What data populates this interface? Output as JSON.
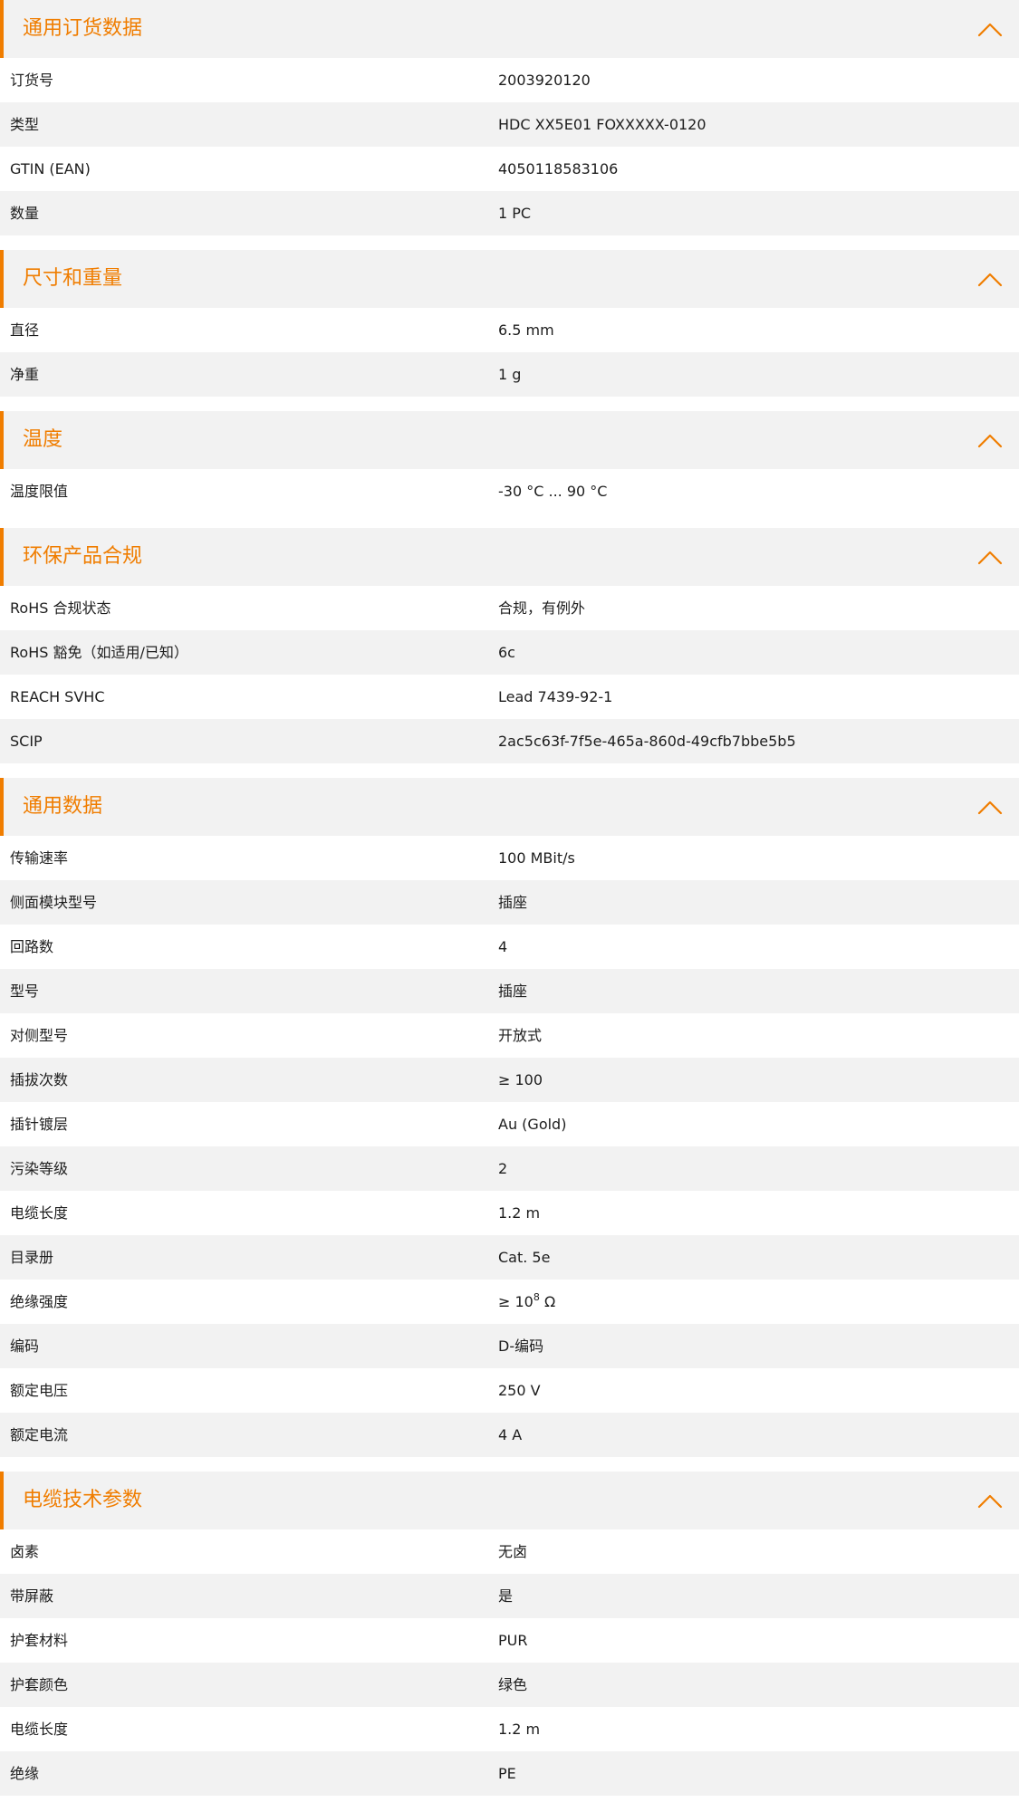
{
  "accent_color": "#f07d00",
  "icons": {
    "collapse": "chevron-up-icon"
  },
  "sections": [
    {
      "id": "ordering",
      "title": "通用订货数据",
      "rows": [
        {
          "label": "订货号",
          "value": "2003920120"
        },
        {
          "label": "类型",
          "value": "HDC XX5E01 FOXXXXX-0120"
        },
        {
          "label": "GTIN (EAN)",
          "value": "4050118583106"
        },
        {
          "label": "数量",
          "value": "1  PC"
        }
      ]
    },
    {
      "id": "dimensions",
      "title": "尺寸和重量",
      "rows": [
        {
          "label": "直径",
          "value": "6.5  mm"
        },
        {
          "label": "净重",
          "value": "1  g"
        }
      ]
    },
    {
      "id": "temperature",
      "title": "温度",
      "rows": [
        {
          "label": "温度限值",
          "value": "-30 °C ... 90 °C"
        }
      ]
    },
    {
      "id": "compliance",
      "title": "环保产品合规",
      "rows": [
        {
          "label": "RoHS 合规状态",
          "value": "合规，有例外"
        },
        {
          "label": "RoHS 豁免（如适用/已知）",
          "value": "6c"
        },
        {
          "label": "REACH SVHC",
          "value": "Lead 7439-92-1"
        },
        {
          "label": "SCIP",
          "value": "2ac5c63f-7f5e-465a-860d-49cfb7bbe5b5"
        }
      ]
    },
    {
      "id": "general",
      "title": "通用数据",
      "rows": [
        {
          "label": "传输速率",
          "value": "100 MBit/s"
        },
        {
          "label": "侧面模块型号",
          "value": "插座"
        },
        {
          "label": "回路数",
          "value": "4"
        },
        {
          "label": "型号",
          "value": "插座"
        },
        {
          "label": "对侧型号",
          "value": "开放式"
        },
        {
          "label": "插拔次数",
          "value": "≥ 100"
        },
        {
          "label": "插针镀层",
          "value": "Au (Gold)"
        },
        {
          "label": "污染等级",
          "value": "2"
        },
        {
          "label": "电缆长度",
          "value": "1.2  m"
        },
        {
          "label": "目录册",
          "value": "Cat. 5e"
        },
        {
          "label": "绝缘强度",
          "value": "≥ 10",
          "sup": "8",
          "suffix": " Ω"
        },
        {
          "label": "编码",
          "value": "D-编码"
        },
        {
          "label": "额定电压",
          "value": "250  V"
        },
        {
          "label": "额定电流",
          "value": "4  A"
        }
      ]
    },
    {
      "id": "cable",
      "title": "电缆技术参数",
      "rows": [
        {
          "label": "卤素",
          "value": "无卤"
        },
        {
          "label": "带屏蔽",
          "value": "是"
        },
        {
          "label": "护套材料",
          "value": "PUR"
        },
        {
          "label": "护套颜色",
          "value": "绿色"
        },
        {
          "label": "电缆长度",
          "value": "1.2  m"
        },
        {
          "label": "绝缘",
          "value": "PE"
        }
      ]
    }
  ]
}
